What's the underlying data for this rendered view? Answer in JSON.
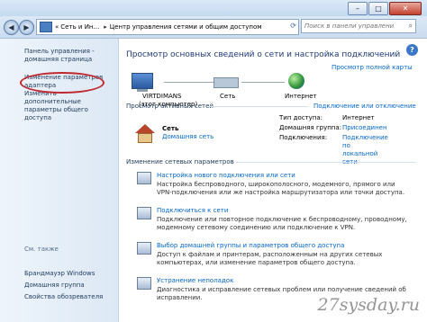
{
  "window": {
    "controls": [
      "–",
      "□",
      "✕"
    ]
  },
  "address": {
    "crumbs": [
      "«",
      "Сеть и Ин...",
      "Центр управления сетями и общим доступом"
    ],
    "separator": "▸",
    "search_placeholder": "Поиск в панели управления"
  },
  "sidebar": {
    "items": [
      {
        "label": "Панель управления -\nдомашняя страница"
      },
      {
        "label": "Изменение параметров\nадаптера"
      },
      {
        "label": "Изменить дополнительные\nпараметры общего доступа"
      }
    ],
    "see_also_title": "См. также",
    "see_also": [
      {
        "label": "Брандмауэр Windows"
      },
      {
        "label": "Домашняя группа"
      },
      {
        "label": "Свойства обозревателя"
      }
    ]
  },
  "main": {
    "title": "Просмотр основных сведений о сети и настройка подключений",
    "full_map_link": "Просмотр полной карты",
    "map": {
      "computer": "VIRTDIMANS",
      "computer_sub": "(этот компьютер)",
      "network": "Сеть",
      "internet": "Интернет"
    },
    "active_title": "Просмотр активных сетей",
    "connect_link": "Подключение или отключение",
    "active_network": {
      "name": "Сеть",
      "type": "Домашняя сеть",
      "access_type_label": "Тип доступа:",
      "access_type_value": "Интернет",
      "homegroup_label": "Домашняя группа:",
      "homegroup_value": "Присоединен",
      "connections_label": "Подключения:",
      "connections_value": "Подключение по\nлокальной сети"
    },
    "change_title": "Изменение сетевых параметров",
    "tasks": [
      {
        "title": "Настройка нового подключения или сети",
        "desc": "Настройка беспроводного, широкополосного, модемного, прямого или VPN-подключения или же настройка маршрутизатора или точки доступа."
      },
      {
        "title": "Подключиться к сети",
        "desc": "Подключение или повторное подключение к беспроводному, проводному, модемному сетевому соединению или подключение к VPN."
      },
      {
        "title": "Выбор домашней группы и параметров общего доступа",
        "desc": "Доступ к файлам и принтерам, расположенным на других сетевых компьютерах, или изменение параметров общего доступа."
      },
      {
        "title": "Устранение неполадок",
        "desc": "Диагностика и исправление сетевых проблем или получение сведений об исправлении."
      }
    ],
    "watermark": "27sysday.ru"
  }
}
